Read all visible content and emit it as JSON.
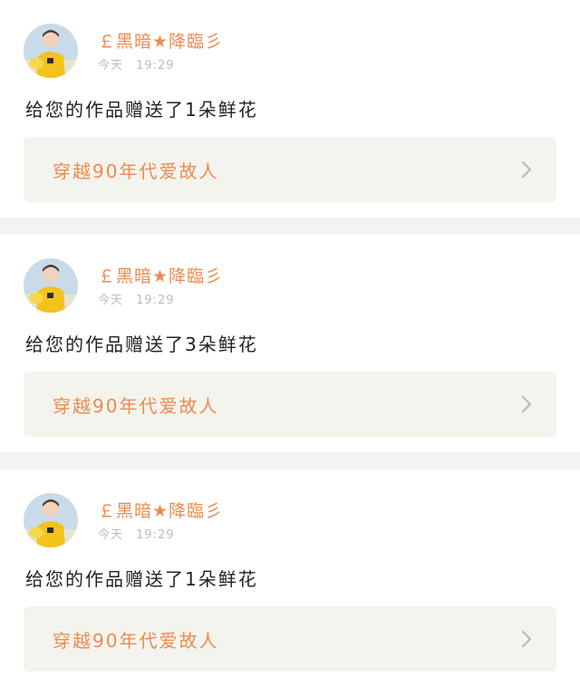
{
  "colors": {
    "accent": "#ef8a4f",
    "card_background": "#f4f4ee",
    "divider": "#f3f3f1",
    "timestamp": "#bdbdbd"
  },
  "notifications": [
    {
      "user_name": "￡黑暗★降臨彡",
      "time_day": "今天",
      "time_clock": "19:29",
      "message": "给您的作品赠送了1朵鲜花",
      "work_title": "穿越90年代爱故人",
      "avatar_icon": "avatar-image",
      "link_icon": "chevron-right-icon"
    },
    {
      "user_name": "￡黑暗★降臨彡",
      "time_day": "今天",
      "time_clock": "19:29",
      "message": "给您的作品赠送了3朵鲜花",
      "work_title": "穿越90年代爱故人",
      "avatar_icon": "avatar-image",
      "link_icon": "chevron-right-icon"
    },
    {
      "user_name": "￡黑暗★降臨彡",
      "time_day": "今天",
      "time_clock": "19:29",
      "message": "给您的作品赠送了1朵鲜花",
      "work_title": "穿越90年代爱故人",
      "avatar_icon": "avatar-image",
      "link_icon": "chevron-right-icon"
    }
  ]
}
